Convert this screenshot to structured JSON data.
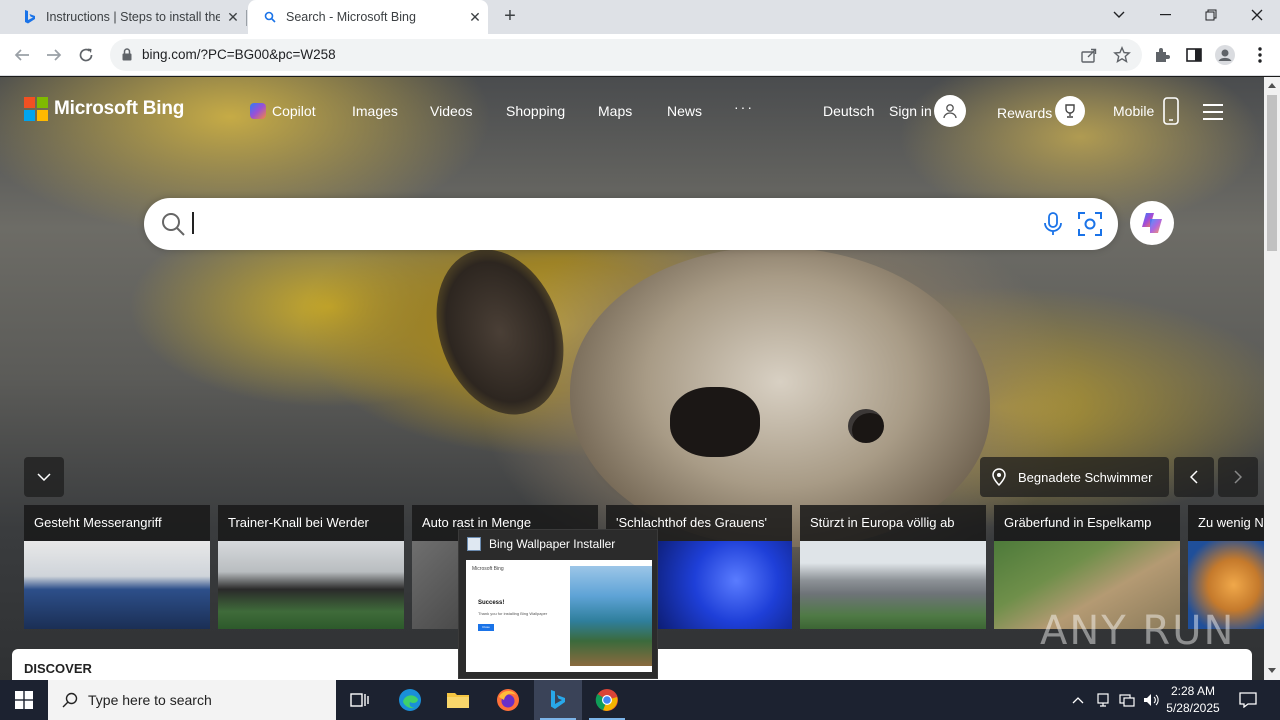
{
  "browser": {
    "tabs": [
      {
        "title": "Instructions | Steps to install the",
        "active": false
      },
      {
        "title": "Search - Microsoft Bing",
        "active": true
      }
    ],
    "url": "bing.com/?PC=BG00&pc=W258"
  },
  "bing": {
    "logo_text": "Microsoft Bing",
    "nav": [
      "Copilot",
      "Images",
      "Videos",
      "Shopping",
      "Maps",
      "News",
      "···"
    ],
    "language": "Deutsch",
    "sign_in": "Sign in",
    "rewards": "Rewards",
    "mobile": "Mobile",
    "search_value": "",
    "location_label": "Begnadete Schwimmer",
    "news": [
      "Gesteht Messerangriff",
      "Trainer-Knall bei Werder",
      "Auto rast in Menge",
      "'Schlachthof des Grauens'",
      "Stürzt in Europa völlig ab",
      "Gräberfund in Espelkamp",
      "Zu wenig N"
    ],
    "discover": "DISCOVER"
  },
  "popup": {
    "title": "Bing Wallpaper Installer",
    "preview_brand": "Microsoft Bing",
    "preview_heading": "Success!",
    "preview_text": "Thank you for installing Bing Wallpaper",
    "preview_button": "Close"
  },
  "watermark": "ANY RUN",
  "taskbar": {
    "search_placeholder": "Type here to search",
    "time": "2:28 AM",
    "date": "5/28/2025"
  },
  "colors": {
    "ms_red": "#f25022",
    "ms_green": "#7fba00",
    "ms_blue": "#00a4ef",
    "ms_yellow": "#ffb900",
    "taskbar": "#1c2230"
  }
}
